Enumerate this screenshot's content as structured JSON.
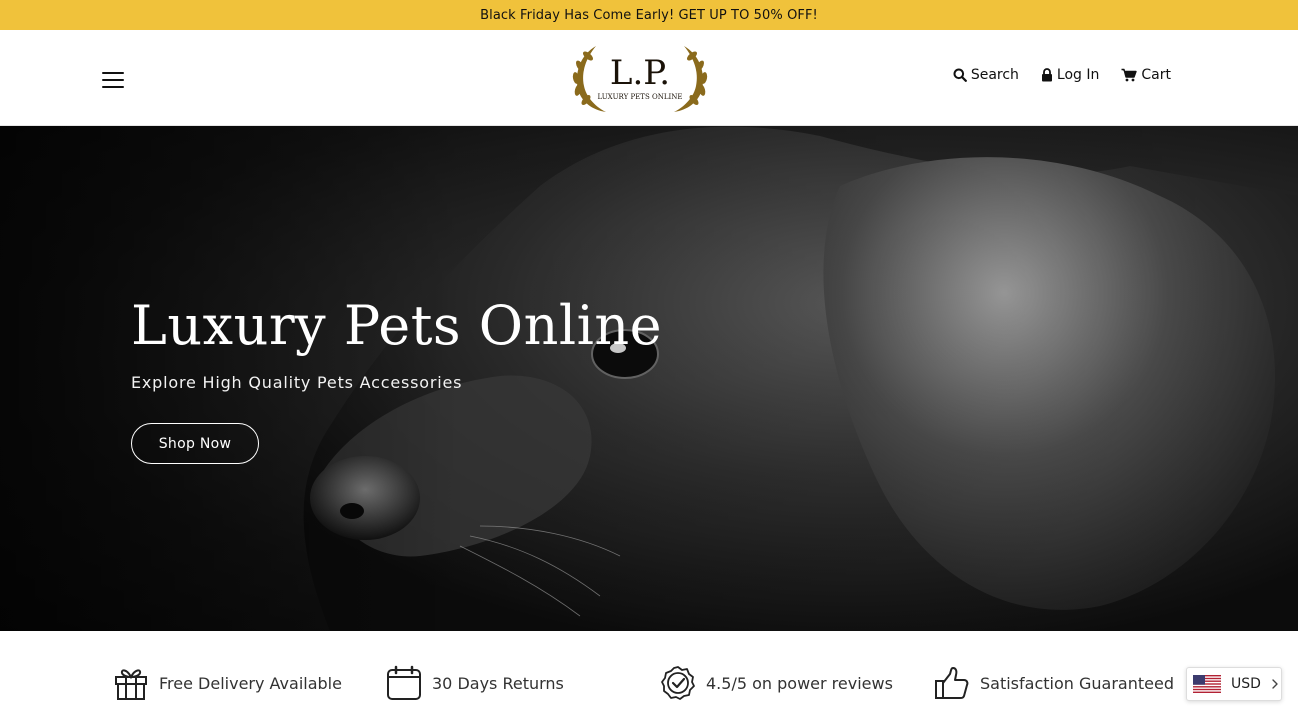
{
  "announcement": {
    "text": "Black Friday Has Come Early! GET UP TO 50% OFF!",
    "bg_color": "#f0c23b"
  },
  "header": {
    "menu_icon": "hamburger-menu-icon",
    "logo": {
      "monogram": "L.P.",
      "tagline": "LUXURY PETS ONLINE",
      "color": "#8a6a1c"
    },
    "nav": [
      {
        "label": "Search",
        "icon": "search-icon"
      },
      {
        "label": "Log In",
        "icon": "lock-icon"
      },
      {
        "label": "Cart",
        "icon": "cart-icon"
      }
    ]
  },
  "hero": {
    "title": "Luxury Pets Online",
    "subtitle": "Explore High Quality Pets Accessories",
    "cta_label": "Shop Now"
  },
  "features": [
    {
      "label": "Free Delivery Available",
      "icon": "gift-icon"
    },
    {
      "label": "30 Days Returns",
      "icon": "calendar-icon"
    },
    {
      "label": "4.5/5 on power reviews",
      "icon": "verified-badge-icon"
    },
    {
      "label": "Satisfaction Guaranteed",
      "icon": "thumbs-up-icon"
    }
  ],
  "currency_selector": {
    "code": "USD",
    "flag_icon": "us-flag-icon",
    "arrow_icon": "chevron-right-icon"
  }
}
